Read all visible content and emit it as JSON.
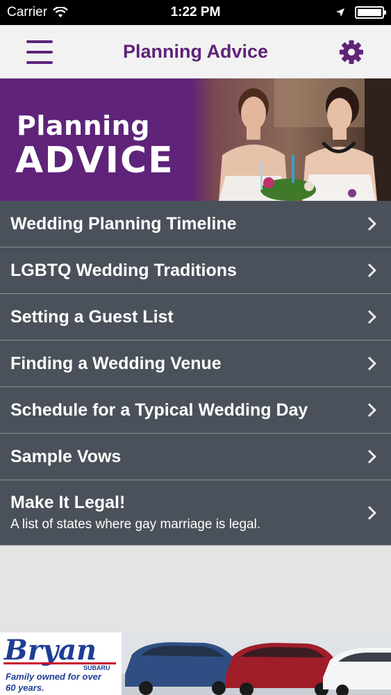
{
  "status_bar": {
    "carrier": "Carrier",
    "time": "1:22 PM"
  },
  "nav": {
    "title": "Planning Advice",
    "menu_icon": "hamburger-menu-icon",
    "settings_icon": "gear-icon"
  },
  "banner": {
    "line1": "Planning",
    "line2": "ADVICE"
  },
  "list": [
    {
      "label": "Wedding Planning Timeline"
    },
    {
      "label": "LGBTQ Wedding Traditions"
    },
    {
      "label": "Setting a Guest List"
    },
    {
      "label": "Finding a Wedding Venue"
    },
    {
      "label": "Schedule for a Typical Wedding Day"
    },
    {
      "label": "Sample Vows"
    },
    {
      "label": "Make It Legal!",
      "subtitle": "A list of states where gay marriage is legal."
    }
  ],
  "ad": {
    "brand": "Bryan",
    "subbrand": "SUBARU",
    "tagline": "Family owned for over 60 years."
  },
  "colors": {
    "accent": "#5e2478",
    "list_bg": "#4a515a",
    "nav_bg": "#f2f2f2",
    "page_bg": "#e4e4e4"
  }
}
